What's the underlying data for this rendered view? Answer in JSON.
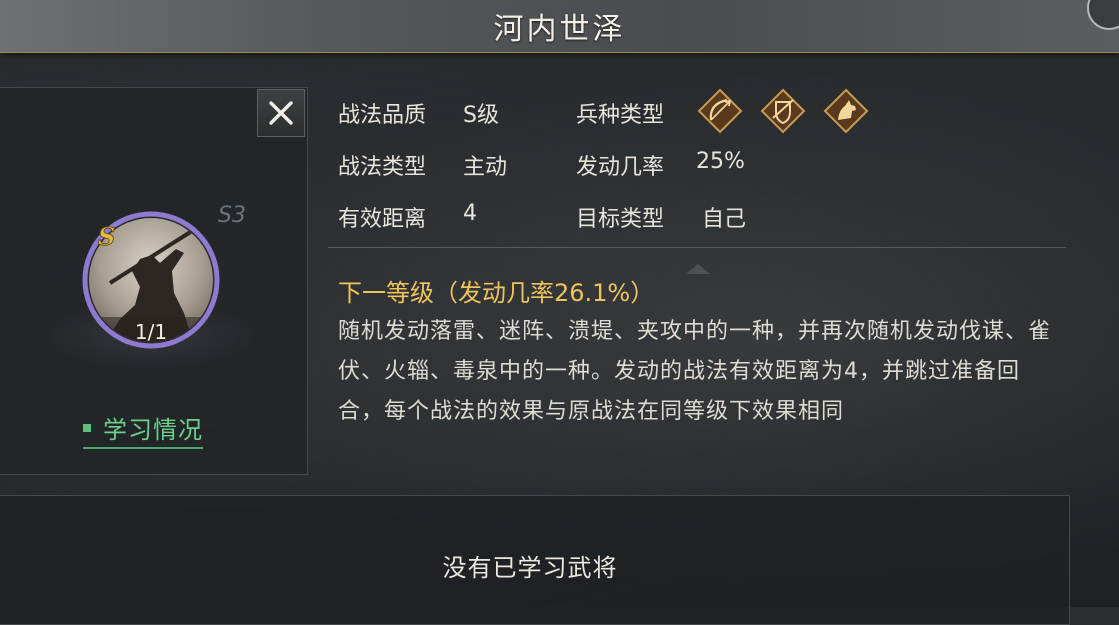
{
  "header": {
    "title": "河内世泽"
  },
  "skill": {
    "grade_letter": "S",
    "season_tag": "S3",
    "count": "1/1",
    "learn_status": "学习情况"
  },
  "info": {
    "quality_label": "战法品质",
    "quality_value": "S级",
    "type_label": "战法类型",
    "type_value": "主动",
    "range_label": "有效距离",
    "range_value": "4",
    "arms_label": "兵种类型",
    "arms": [
      "archer-icon",
      "shield-icon",
      "cavalry-icon"
    ],
    "rate_label": "发动几率",
    "rate_value": "25%",
    "target_label": "目标类型",
    "target_value": "自己"
  },
  "next_level": "下一等级（发动几率26.1%）",
  "description": "随机发动落雷、迷阵、溃堤、夹攻中的一种，并再次随机发动伐谋、雀伏、火辎、毒泉中的一种。发动的战法有效距离为4，并跳过准备回合，每个战法的效果与原战法在同等级下效果相同",
  "bottom": {
    "empty_message": "没有已学习武将"
  },
  "colors": {
    "accent_gold": "#f0c45c",
    "status_green": "#6fd08c",
    "emblem_ring": "#8e7bd1"
  }
}
